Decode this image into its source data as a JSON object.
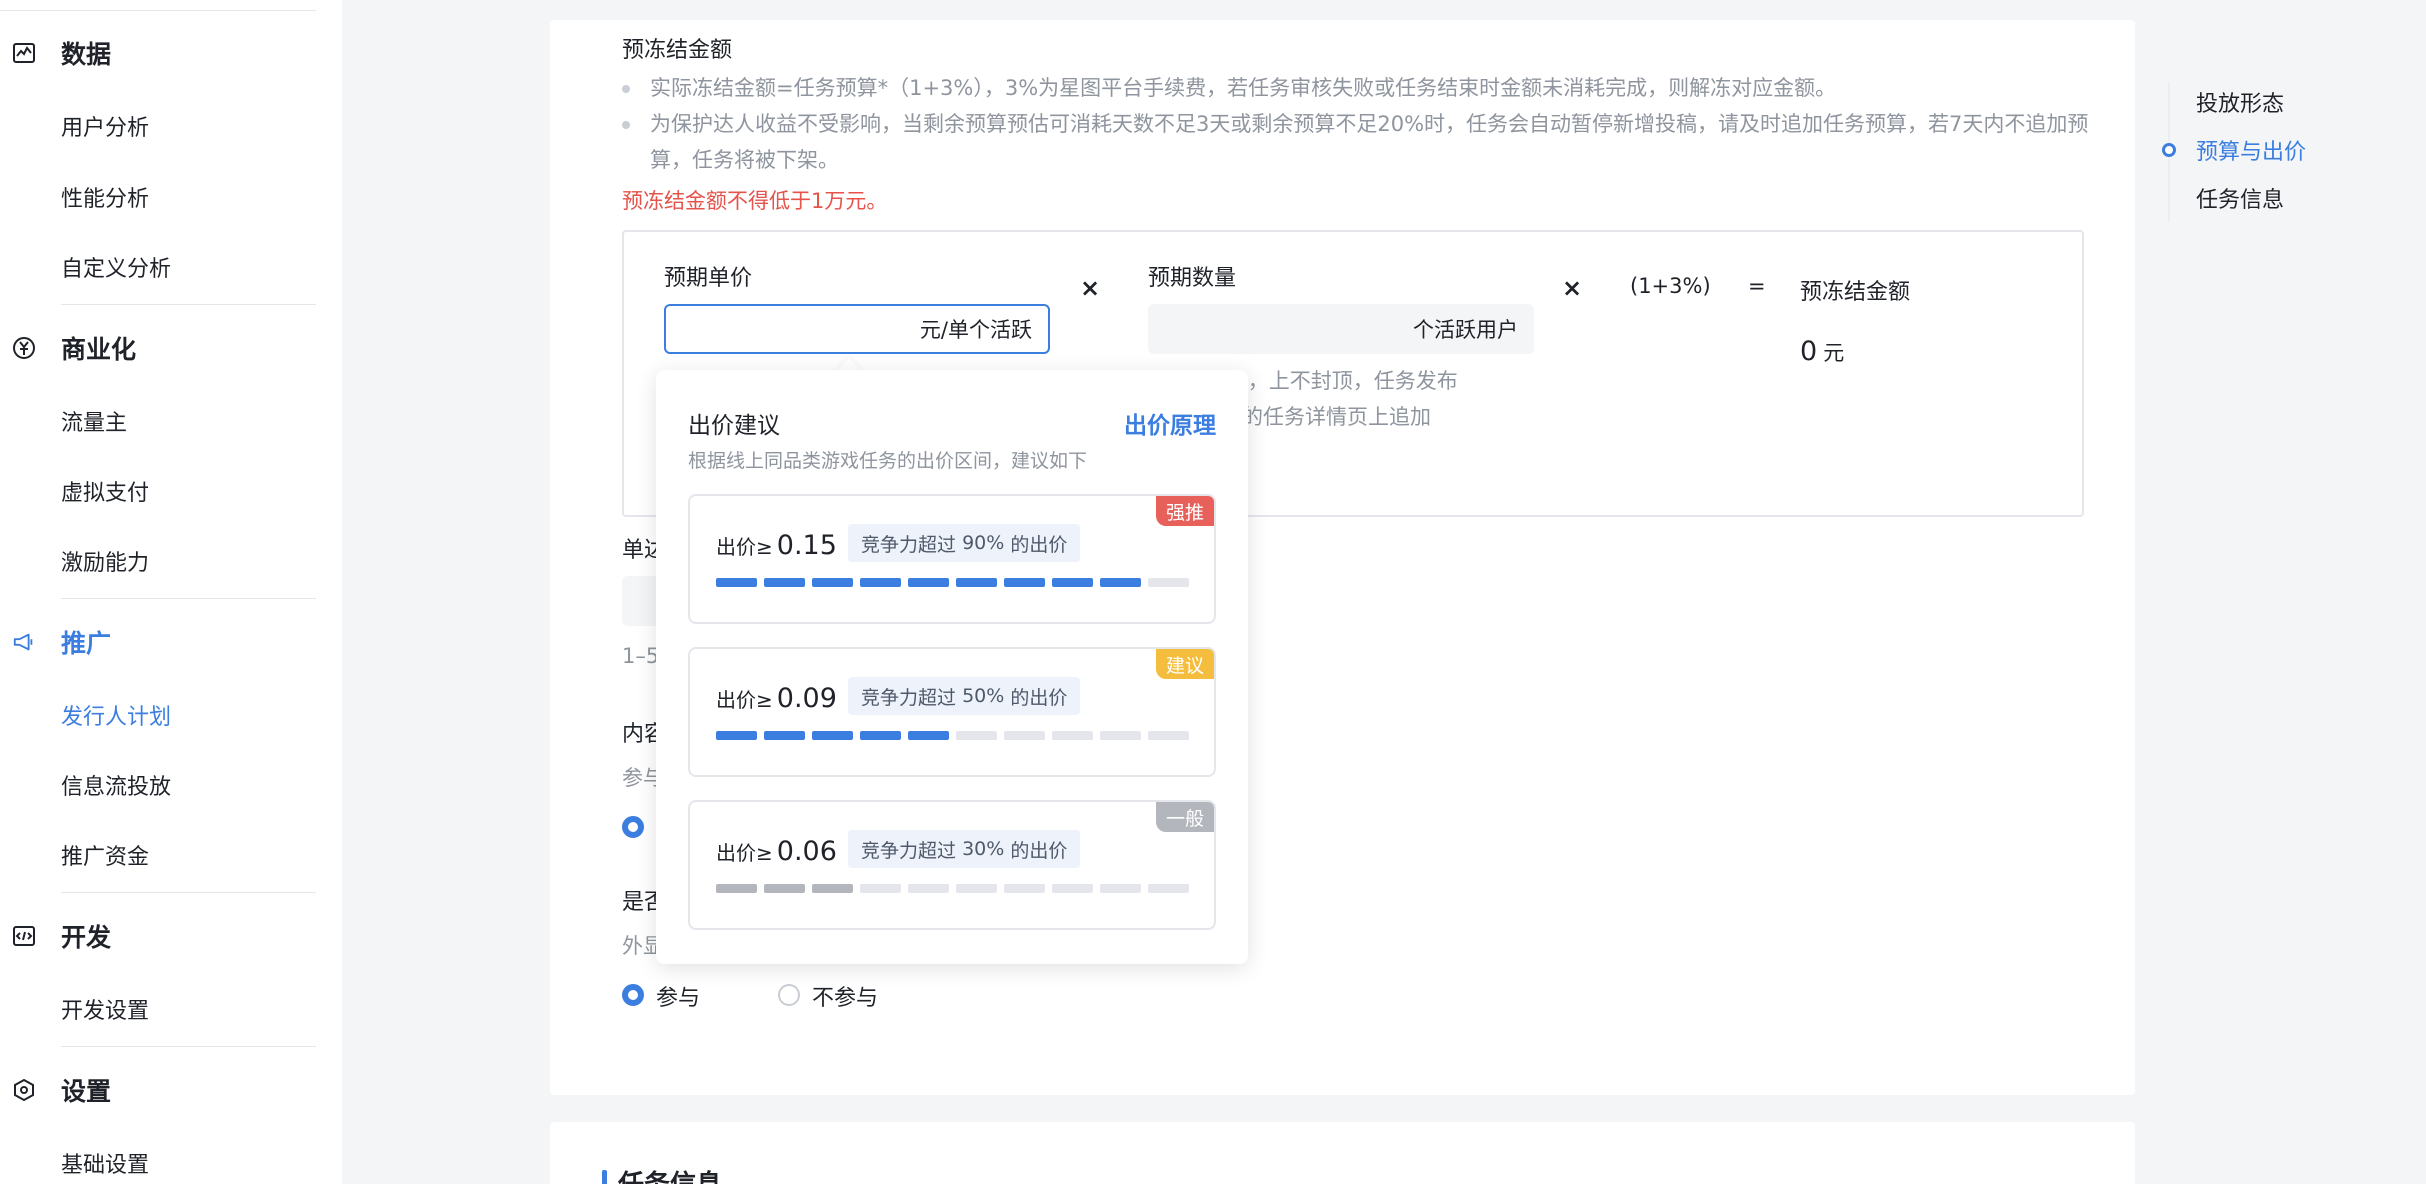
{
  "sidebar": {
    "groups": [
      {
        "label": "数据",
        "icon": "chart-icon",
        "items": [
          "用户分析",
          "性能分析",
          "自定义分析"
        ]
      },
      {
        "label": "商业化",
        "icon": "yuan-icon",
        "items": [
          "流量主",
          "虚拟支付",
          "激励能力"
        ]
      },
      {
        "label": "推广",
        "icon": "megaphone-icon",
        "items": [
          "发行人计划",
          "信息流投放",
          "推广资金"
        ]
      },
      {
        "label": "开发",
        "icon": "code-icon",
        "items": [
          "开发设置"
        ]
      },
      {
        "label": "设置",
        "icon": "hexagon-settings-icon",
        "items": [
          "基础设置"
        ]
      }
    ],
    "active_group": "推广",
    "active_item": "发行人计划"
  },
  "main": {
    "section_title": "预冻结金额",
    "bullets": [
      "实际冻结金额=任务预算*（1+3%），3%为星图平台手续费，若任务审核失败或任务结束时金额未消耗完成，则解冻对应金额。",
      "为保护达人收益不受影响，当剩余预算预估可消耗天数不足3天或剩余预算不足20%时，任务会自动暂停新增投稿，请及时追加任务预算，若7天内不追加预算，任务将被下架。"
    ],
    "warning": "预冻结金额不得低于1万元。",
    "formula": {
      "unit_price_label": "预期单价",
      "unit_price_suffix": "元/单个活跃",
      "times1": "×",
      "quantity_label": "预期数量",
      "quantity_suffix": "个活跃用户",
      "times2": "×",
      "fee": "(1+3%)",
      "equals": "=",
      "result_label": "预冻结金额",
      "result_value": "0",
      "result_unit": "元",
      "hint_line1": "00个，上不封顶，任务发布",
      "hint_line2": "任务的任务详情页上追加"
    },
    "field2_label": "单达",
    "field2_hint": "1–5",
    "field3_label": "内容",
    "field3_sub": "参与",
    "field4_label": "是否",
    "field4_sub": "外显",
    "radio_join": "参与",
    "radio_no_join": "不参与",
    "next_section_title": "任务信息"
  },
  "popover": {
    "title": "出价建议",
    "link": "出价原理",
    "subtitle": "根据线上同品类游戏任务的出价区间，建议如下",
    "price_prefix": "出价≥",
    "tag_prefix": "竞争力超过",
    "tag_suffix": "的出价",
    "options": [
      {
        "price": "0.15",
        "percent": "90%",
        "badge": "强推",
        "badge_color": "#e8605a",
        "filled": 9,
        "fill_color": "#3b7ee0"
      },
      {
        "price": "0.09",
        "percent": "50%",
        "badge": "建议",
        "badge_color": "#f5bd3d",
        "filled": 5,
        "fill_color": "#3b7ee0"
      },
      {
        "price": "0.06",
        "percent": "30%",
        "badge": "一般",
        "badge_color": "#b3b6bd",
        "filled": 3,
        "fill_color": "#b3b6bd"
      }
    ],
    "segments_total": 10
  },
  "anchor_nav": {
    "items": [
      "投放形态",
      "预算与出价",
      "任务信息"
    ],
    "active": "预算与出价"
  },
  "colors": {
    "accent": "#3b7ee0",
    "warning": "#e5534b"
  }
}
